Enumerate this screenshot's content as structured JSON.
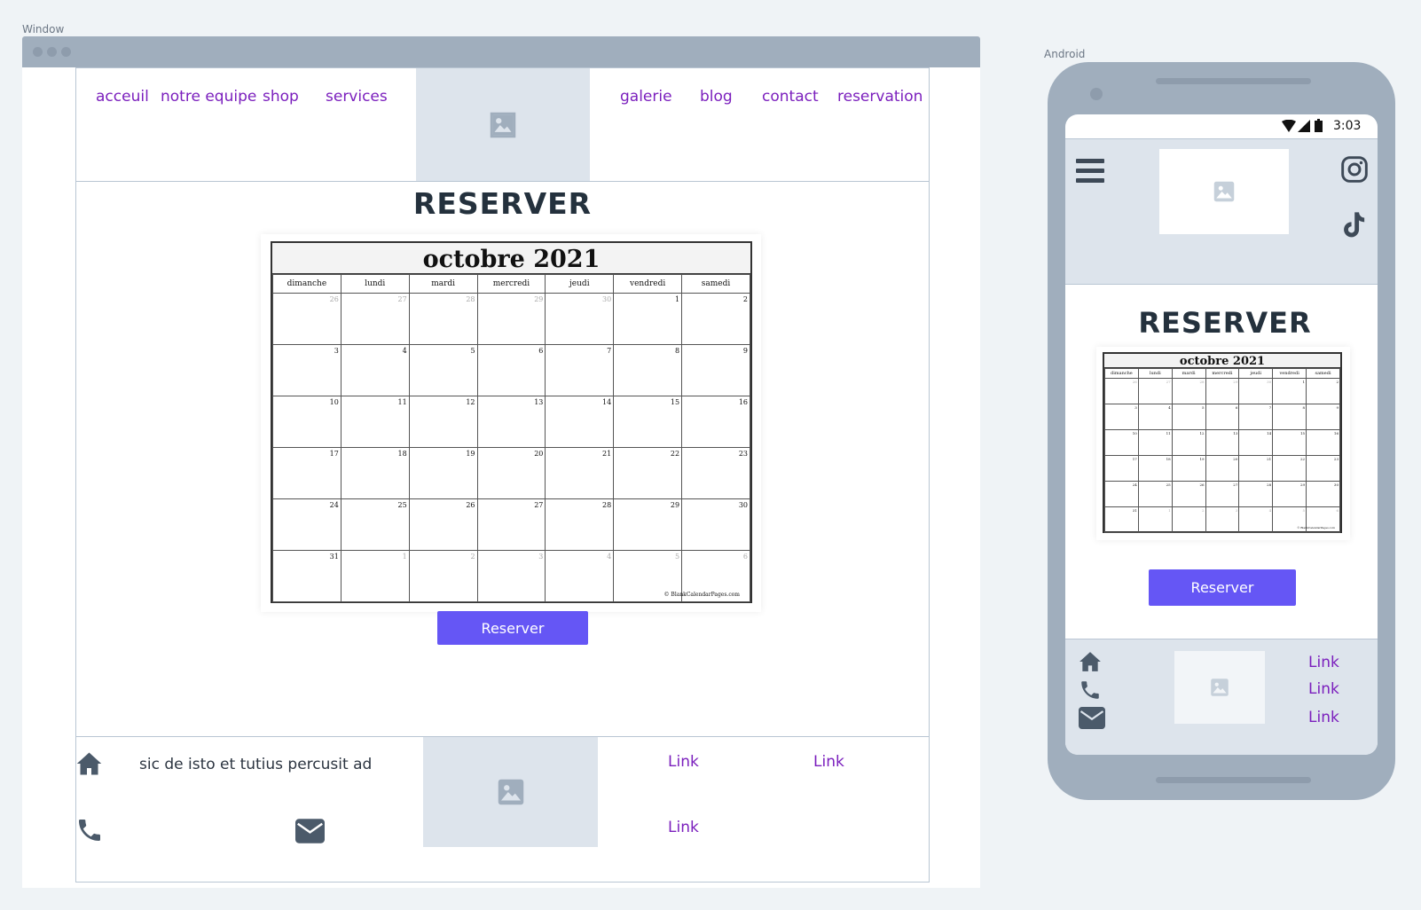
{
  "desktop": {
    "frame_label": "Window",
    "nav": {
      "left": [
        "acceuil",
        "notre equipe",
        "shop",
        "services"
      ],
      "right": [
        "galerie",
        "blog",
        "contact",
        "reservation"
      ]
    },
    "title": "RESERVER",
    "button": "Reserver",
    "footer": {
      "text": "sic de isto et tutius percusit ad",
      "links": [
        "Link",
        "Link",
        "Link"
      ]
    }
  },
  "calendar": {
    "month": "octobre 2021",
    "days": [
      "dimanche",
      "lundi",
      "mardi",
      "mercredi",
      "jeudi",
      "vendredi",
      "samedi"
    ],
    "weeks": [
      [
        {
          "d": "26",
          "m": true
        },
        {
          "d": "27",
          "m": true
        },
        {
          "d": "28",
          "m": true
        },
        {
          "d": "29",
          "m": true
        },
        {
          "d": "30",
          "m": true
        },
        {
          "d": "1"
        },
        {
          "d": "2"
        }
      ],
      [
        {
          "d": "3"
        },
        {
          "d": "4"
        },
        {
          "d": "5"
        },
        {
          "d": "6"
        },
        {
          "d": "7"
        },
        {
          "d": "8"
        },
        {
          "d": "9"
        }
      ],
      [
        {
          "d": "10"
        },
        {
          "d": "11"
        },
        {
          "d": "12"
        },
        {
          "d": "13"
        },
        {
          "d": "14"
        },
        {
          "d": "15"
        },
        {
          "d": "16"
        }
      ],
      [
        {
          "d": "17"
        },
        {
          "d": "18"
        },
        {
          "d": "19"
        },
        {
          "d": "20"
        },
        {
          "d": "21"
        },
        {
          "d": "22"
        },
        {
          "d": "23"
        }
      ],
      [
        {
          "d": "24"
        },
        {
          "d": "25"
        },
        {
          "d": "26"
        },
        {
          "d": "27"
        },
        {
          "d": "28"
        },
        {
          "d": "29"
        },
        {
          "d": "30"
        }
      ],
      [
        {
          "d": "31"
        },
        {
          "d": "1",
          "m": true
        },
        {
          "d": "2",
          "m": true
        },
        {
          "d": "3",
          "m": true
        },
        {
          "d": "4",
          "m": true
        },
        {
          "d": "5",
          "m": true
        },
        {
          "d": "6",
          "m": true
        }
      ]
    ],
    "copyright": "© BlankCalendarPages.com"
  },
  "android": {
    "frame_label": "Android",
    "time": "3:03",
    "title": "RESERVER",
    "button": "Reserver",
    "links": [
      "Link",
      "Link",
      "Link"
    ]
  },
  "colors": {
    "link": "#7b1fbd",
    "button": "#6556f5",
    "frame": "#a0aebd",
    "placeholder": "#dde4ec"
  },
  "icons": [
    "image-placeholder-icon",
    "home-icon",
    "phone-icon",
    "envelope-icon",
    "hamburger-menu-icon",
    "instagram-icon",
    "tiktok-icon",
    "wifi-icon",
    "signal-icon",
    "battery-icon"
  ]
}
